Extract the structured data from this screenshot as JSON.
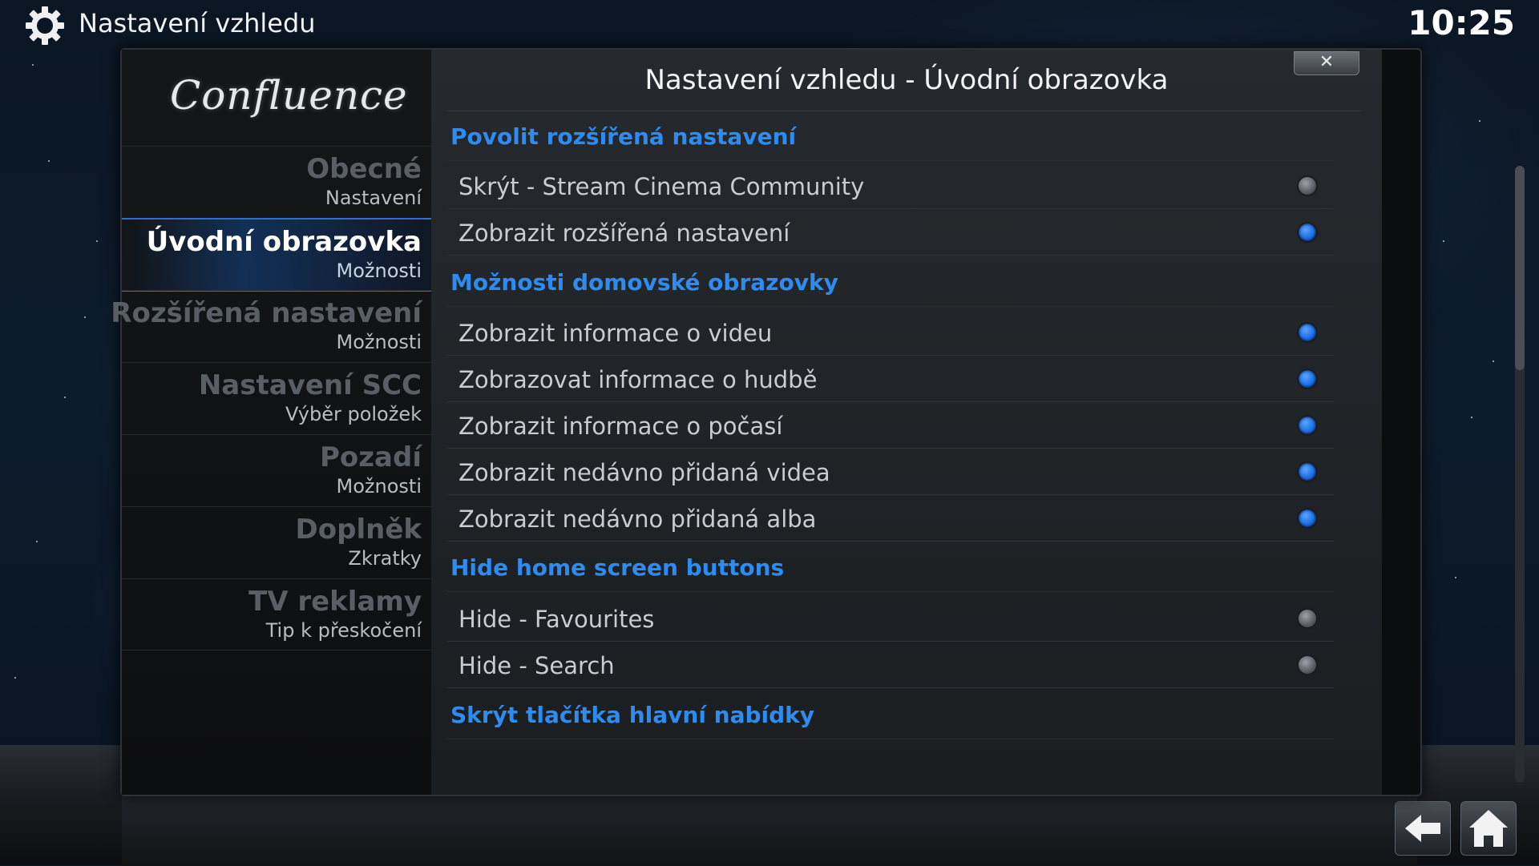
{
  "header": {
    "title": "Nastavení vzhledu",
    "clock": "10:25"
  },
  "sidebar": {
    "logo": "Confluence",
    "items": [
      {
        "name": "Obecné",
        "sub": "Nastavení"
      },
      {
        "name": "Úvodní obrazovka",
        "sub": "Možnosti"
      },
      {
        "name": "Rozšířená nastavení",
        "sub": "Možnosti"
      },
      {
        "name": "Nastavení SCC",
        "sub": "Výběr položek"
      },
      {
        "name": "Pozadí",
        "sub": "Možnosti"
      },
      {
        "name": "Doplněk",
        "sub": "Zkratky"
      },
      {
        "name": "TV reklamy",
        "sub": "Tip k přeskočení"
      }
    ]
  },
  "dialog": {
    "title": "Nastavení vzhledu - Úvodní obrazovka",
    "close_label": "✕"
  },
  "settings": [
    {
      "type": "section",
      "label": "Povolit rozšířená nastavení"
    },
    {
      "type": "toggle",
      "label": "Skrýt - Stream Cinema Community",
      "on": false
    },
    {
      "type": "toggle",
      "label": "Zobrazit rozšířená nastavení",
      "on": true
    },
    {
      "type": "section",
      "label": "Možnosti domovské obrazovky"
    },
    {
      "type": "toggle",
      "label": "Zobrazit informace o videu",
      "on": true
    },
    {
      "type": "toggle",
      "label": "Zobrazovat informace o hudbě",
      "on": true
    },
    {
      "type": "toggle",
      "label": "Zobrazit informace o počasí",
      "on": true
    },
    {
      "type": "toggle",
      "label": "Zobrazit nedávno přidaná videa",
      "on": true
    },
    {
      "type": "toggle",
      "label": "Zobrazit nedávno přidaná alba",
      "on": true
    },
    {
      "type": "section",
      "label": "Hide home screen buttons"
    },
    {
      "type": "toggle",
      "label": "Hide - Favourites",
      "on": false
    },
    {
      "type": "toggle",
      "label": "Hide - Search",
      "on": false
    },
    {
      "type": "section",
      "label": "Skrýt tlačítka hlavní nabídky"
    }
  ],
  "colors": {
    "accent": "#2e8bf0",
    "radio_on": "#1b6ee6",
    "radio_off": "#5e6268"
  },
  "icons": {
    "settings": "gear-icon",
    "back": "back-arrow-icon",
    "home": "home-icon",
    "close": "close-icon"
  }
}
